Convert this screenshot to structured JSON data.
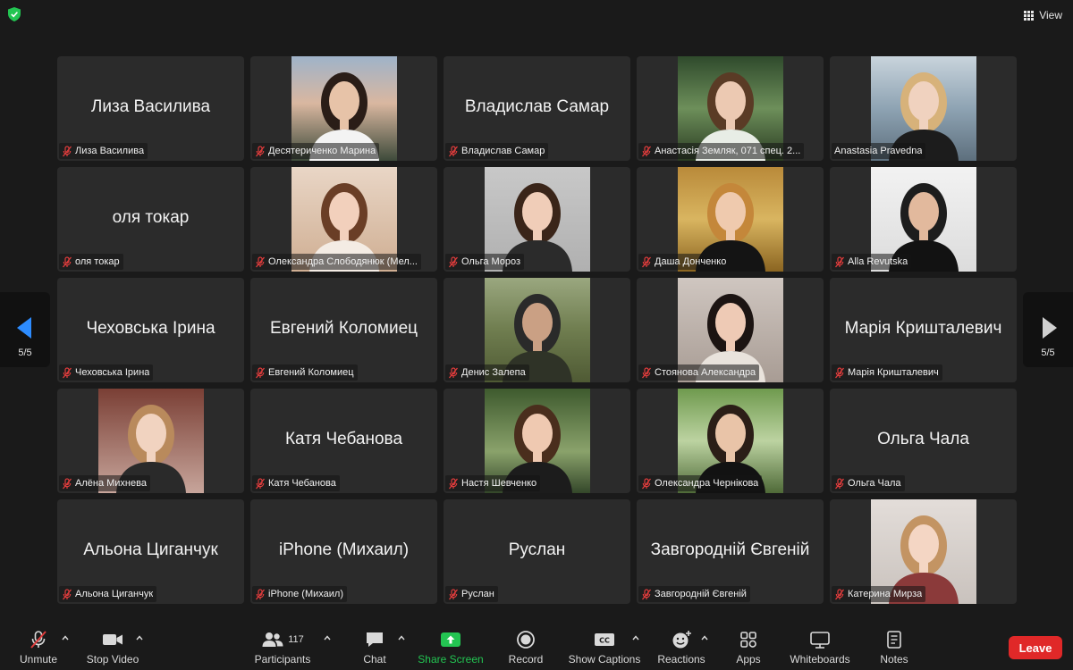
{
  "topbar": {
    "view_label": "View"
  },
  "pager": {
    "left_label": "5/5",
    "right_label": "5/5"
  },
  "participants": [
    {
      "display_name": "Лиза Василива",
      "plate": "Лиза Василива",
      "video": false
    },
    {
      "display_name": "",
      "plate": "Десятериченко Марина",
      "video": true,
      "scene": "city"
    },
    {
      "display_name": "Владислав Самар",
      "plate": "Владислав Самар",
      "video": false
    },
    {
      "display_name": "",
      "plate": "Анастасія Земляк, 071 спец. 2...",
      "video": true,
      "scene": "garden"
    },
    {
      "display_name": "",
      "plate": "Anastasia Pravedna",
      "video": true,
      "scene": "sea",
      "muted": false
    },
    {
      "display_name": "оля токар",
      "plate": "оля токар",
      "video": false
    },
    {
      "display_name": "",
      "plate": "Олександра Слободянюк (Мел...",
      "video": true,
      "scene": "warm"
    },
    {
      "display_name": "",
      "plate": "Ольга Мороз",
      "video": true,
      "scene": "portrait"
    },
    {
      "display_name": "",
      "plate": "Даша Донченко",
      "video": true,
      "scene": "gold"
    },
    {
      "display_name": "",
      "plate": "Alla Revutska",
      "video": true,
      "scene": "office"
    },
    {
      "display_name": "Чеховська Ірина",
      "plate": "Чеховська Ірина",
      "video": false
    },
    {
      "display_name": "Евгений Коломиец",
      "plate": "Евгений Коломиец",
      "video": false
    },
    {
      "display_name": "",
      "plate": "Денис Залепа",
      "video": true,
      "scene": "field"
    },
    {
      "display_name": "",
      "plate": "Стоянова Александра",
      "video": true,
      "scene": "portrait2"
    },
    {
      "display_name": "Марія Кришталевич",
      "plate": "Марія Кришталевич",
      "video": false
    },
    {
      "display_name": "",
      "plate": "Алёна Михнева",
      "video": true,
      "scene": "glasses"
    },
    {
      "display_name": "Катя Чебанова",
      "plate": "Катя Чебанова",
      "video": false
    },
    {
      "display_name": "",
      "plate": "Настя Шевченко",
      "video": true,
      "scene": "forest"
    },
    {
      "display_name": "",
      "plate": "Олександра Чернікова",
      "video": true,
      "scene": "park"
    },
    {
      "display_name": "Ольга Чала",
      "plate": "Ольга Чала",
      "video": false
    },
    {
      "display_name": "Альона Циганчук",
      "plate": "Альона Циганчук",
      "video": false
    },
    {
      "display_name": "iPhone (Михаил)",
      "plate": "iPhone (Михаил)",
      "video": false
    },
    {
      "display_name": "Руслан",
      "plate": "Руслан",
      "video": false
    },
    {
      "display_name": "Завгородній Євгеній",
      "plate": "Завгородній Євгеній",
      "video": false
    },
    {
      "display_name": "",
      "plate": "Катерина Мирза",
      "video": true,
      "scene": "blonde"
    }
  ],
  "toolbar": {
    "unmute": "Unmute",
    "stop_video": "Stop Video",
    "participants": "Participants",
    "participants_count": "117",
    "chat": "Chat",
    "share_screen": "Share Screen",
    "record": "Record",
    "show_captions": "Show Captions",
    "cc_badge": "CC",
    "reactions": "Reactions",
    "apps": "Apps",
    "whiteboards": "Whiteboards",
    "notes": "Notes",
    "leave": "Leave"
  },
  "colors": {
    "accent_blue": "#2d8cff",
    "share_green": "#23c552",
    "leave_red": "#e02828",
    "muted_red": "#e03c3c",
    "tile_bg": "#2b2b2b"
  }
}
